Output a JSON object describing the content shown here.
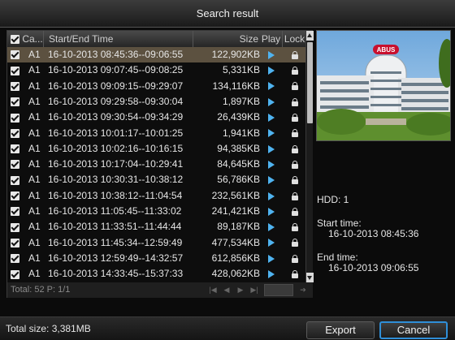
{
  "window": {
    "title": "Search result"
  },
  "table": {
    "headers": {
      "camera": "Ca...",
      "time": "Start/End Time",
      "size": "Size",
      "play": "Play",
      "lock": "Lock"
    },
    "rows": [
      {
        "camera": "A1",
        "time": "16-10-2013 08:45:36--09:06:55",
        "size": "122,902KB",
        "checked": true,
        "selected": true
      },
      {
        "camera": "A1",
        "time": "16-10-2013 09:07:45--09:08:25",
        "size": "5,331KB",
        "checked": true
      },
      {
        "camera": "A1",
        "time": "16-10-2013 09:09:15--09:29:07",
        "size": "134,116KB",
        "checked": true
      },
      {
        "camera": "A1",
        "time": "16-10-2013 09:29:58--09:30:04",
        "size": "1,897KB",
        "checked": true
      },
      {
        "camera": "A1",
        "time": "16-10-2013 09:30:54--09:34:29",
        "size": "26,439KB",
        "checked": true
      },
      {
        "camera": "A1",
        "time": "16-10-2013 10:01:17--10:01:25",
        "size": "1,941KB",
        "checked": true
      },
      {
        "camera": "A1",
        "time": "16-10-2013 10:02:16--10:16:15",
        "size": "94,385KB",
        "checked": true
      },
      {
        "camera": "A1",
        "time": "16-10-2013 10:17:04--10:29:41",
        "size": "84,645KB",
        "checked": true
      },
      {
        "camera": "A1",
        "time": "16-10-2013 10:30:31--10:38:12",
        "size": "56,786KB",
        "checked": true
      },
      {
        "camera": "A1",
        "time": "16-10-2013 10:38:12--11:04:54",
        "size": "232,561KB",
        "checked": true
      },
      {
        "camera": "A1",
        "time": "16-10-2013 11:05:45--11:33:02",
        "size": "241,421KB",
        "checked": true
      },
      {
        "camera": "A1",
        "time": "16-10-2013 11:33:51--11:44:44",
        "size": "89,187KB",
        "checked": true
      },
      {
        "camera": "A1",
        "time": "16-10-2013 11:45:34--12:59:49",
        "size": "477,534KB",
        "checked": true
      },
      {
        "camera": "A1",
        "time": "16-10-2013 12:59:49--14:32:57",
        "size": "612,856KB",
        "checked": true
      },
      {
        "camera": "A1",
        "time": "16-10-2013 14:33:45--15:37:33",
        "size": "428,062KB",
        "checked": true
      }
    ],
    "footer": {
      "total": "Total: 52  P: 1/1"
    }
  },
  "details": {
    "hdd": "HDD: 1",
    "start_label": "Start time:",
    "start_value": "16-10-2013 08:45:36",
    "end_label": "End time:",
    "end_value": "16-10-2013 09:06:55"
  },
  "preview": {
    "sign_text": "ABUS"
  },
  "bottom": {
    "total_size": "Total size: 3,381MB",
    "export_label": "Export",
    "cancel_label": "Cancel"
  },
  "colors": {
    "selected_row": "#5c5140",
    "play_icon": "#4fb3f0",
    "cancel_border": "#2f8fd8"
  },
  "icons": {
    "play": "play-icon",
    "lock": "lock-icon",
    "checkbox": "checkbox-checked-icon"
  }
}
